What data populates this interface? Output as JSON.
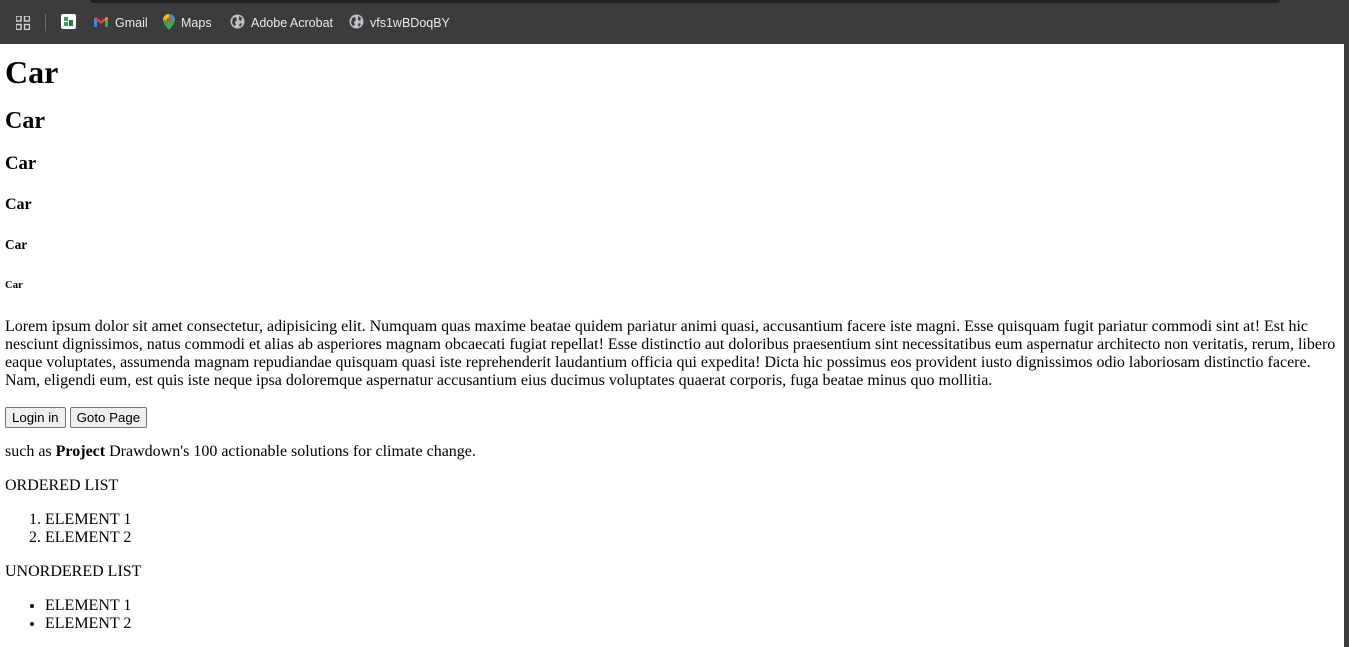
{
  "browser": {
    "bookmarks": [
      {
        "label": "",
        "icon": "sheets-favicon"
      },
      {
        "label": "Gmail",
        "icon": "gmail-icon"
      },
      {
        "label": "Maps",
        "icon": "maps-icon"
      },
      {
        "label": "Adobe Acrobat",
        "icon": "globe-icon"
      },
      {
        "label": "vfs1wBDoqBY",
        "icon": "globe-icon"
      }
    ],
    "colors": {
      "bar": "#3c3c3c",
      "text": "#e8eaed"
    }
  },
  "page": {
    "headings": [
      "Car",
      "Car",
      "Car",
      "Car",
      "Car",
      "Car"
    ],
    "paragraph": "Lorem ipsum dolor sit amet consectetur, adipisicing elit. Numquam quas maxime beatae quidem pariatur animi quasi, accusantium facere iste magni. Esse quisquam fugit pariatur commodi sint at! Est hic nesciunt dignissimos, natus commodi et alias ab asperiores magnam obcaecati fugiat repellat! Esse distinctio aut doloribus praesentium sint necessitatibus eum aspernatur architecto non veritatis, rerum, libero eaque voluptates, assumenda magnam repudiandae quisquam quasi iste reprehenderit laudantium officia qui expedita! Dicta hic possimus eos provident iusto dignissimos odio laboriosam distinctio facere. Nam, eligendi eum, est quis iste neque ipsa doloremque aspernatur accusantium eius ducimus voluptates quaerat corporis, fuga beatae minus quo mollitia.",
    "buttons": {
      "login": "Login in",
      "goto": "Goto Page"
    },
    "sentence": {
      "prefix": "such as ",
      "bold": "Project",
      "suffix": " Drawdown's 100 actionable solutions for climate change."
    },
    "ordered_list": {
      "title": "ORDERED LIST",
      "items": [
        "ELEMENT 1",
        "ELEMENT 2"
      ]
    },
    "unordered_list": {
      "title": "UNORDERED LIST",
      "items": [
        "ELEMENT 1",
        "ELEMENT 2"
      ]
    }
  }
}
